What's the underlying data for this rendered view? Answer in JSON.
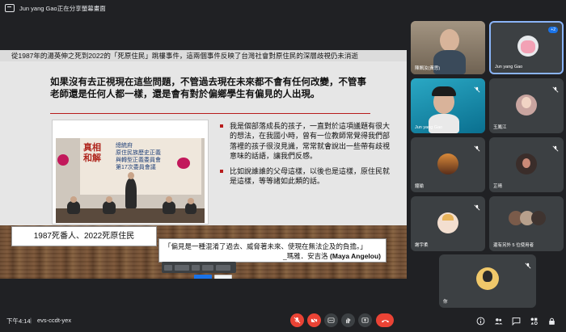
{
  "header": {
    "presenting_title": "Jun yang Gao正在分享螢幕畫面"
  },
  "slide": {
    "header_text": "從1987年的湯英伸之死到2022的「死原住民」跳樓事件，這兩個事件反映了台灣社會對原住民的深層歧視仍未消逝",
    "main_text": "如果沒有去正視現在這些問題，不管過去現在未來都不會有任何改變，不管事老師還是任何人都一樣，還是會有對於偏鄉學生有偏見的人出現。",
    "photo_caption_top": "",
    "photo_title": "",
    "photo_red_text": "真相\n和解",
    "photo_blue_text": "總統府\n原住民族歷史正義\n與轉型正義委員會\n第17次委員會議",
    "caption": "1987死番人、2022死原住民",
    "bullets": [
      "我是個部落成長的孩子，一直對於這項議題有很大的想法，在我國小時，曾有一位教師常覺得我們部落裡的孩子很沒見識，常常就會說出一些帶有歧視意味的話語，讓我們反感。",
      "比如說誰誰的父母這樣，以後也是這樣，原住民就是這樣，等等諸如此類的話。"
    ],
    "quote_line1": "「偏見是一種混淆了過去、威脅著未來、使現在無法企及的負擔。」",
    "quote_author_prefix": "_瑪雅．安吉洛 ",
    "quote_author": "(Maya Angelou)"
  },
  "participants": [
    {
      "name": "陳姵汝(黃思)",
      "muted": false
    },
    {
      "name": "Jun yang Gao",
      "muted": false,
      "badge": "+2"
    },
    {
      "name": "Jun yang Gao",
      "muted": true
    },
    {
      "name": "玉鳳江",
      "muted": true
    },
    {
      "name": "鐘瑜",
      "muted": true
    },
    {
      "name": "芷晴",
      "muted": true
    },
    {
      "name": "謝宇柔",
      "muted": true
    },
    {
      "name": "還有另外 5 位使用者",
      "muted": false
    },
    {
      "name": "你",
      "muted": true
    }
  ],
  "bottom": {
    "time": "下午4:14",
    "separator": "|",
    "meeting_code": "evs-ccdt-yex"
  },
  "icons": {
    "mic": "mic-off-icon",
    "camera": "camera-off-icon",
    "captions": "captions-icon",
    "hand": "raise-hand-icon",
    "present": "present-icon",
    "more": "more-options-icon",
    "end": "end-call-icon",
    "info": "info-icon",
    "people": "people-icon",
    "chat": "chat-icon",
    "activities": "activities-icon",
    "lock": "host-controls-icon"
  },
  "colors": {
    "end_call": "#ea4335",
    "background": "#202124",
    "tile": "#3c4043",
    "accent_rule": "#b71c1c"
  }
}
